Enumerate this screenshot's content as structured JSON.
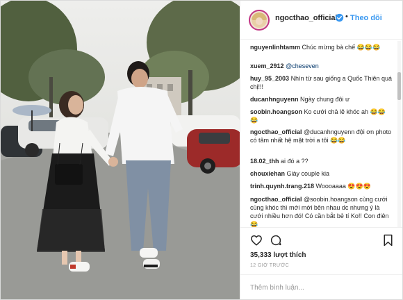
{
  "post": {
    "author": "ngocthao_official",
    "follow_label": "Theo dõi",
    "separator": "•",
    "verified": true,
    "likes": "35,333 lượt thích",
    "time_ago": "12 GIỜ TRƯỚC",
    "comment_placeholder": "Thêm bình luận..."
  },
  "comments": [
    {
      "user": "nguyenlinhtamm",
      "text": "Chúc mừng bà chế",
      "emoji": "😂😂😂",
      "mention": false
    },
    {
      "user": "xuem_2912",
      "text": "@cheseven",
      "emoji": "",
      "mention": true
    },
    {
      "user": "huy_95_2003",
      "text": "Nhìn từ sau giống a Quốc Thiên quá chị!!!",
      "emoji": "",
      "mention": false
    },
    {
      "user": "ducanhnguyenn",
      "text": "Ngày chung đôi ư",
      "emoji": "",
      "mention": false
    },
    {
      "user": "soobin.hoangson",
      "text": "Ko cưới chả lẽ khóc ah",
      "emoji": "😂😂😂",
      "mention": false
    },
    {
      "user": "ngocthao_official",
      "text": "@ducanhnguyenn đội ơn photo có tâm nhất hệ mặt trời a tôi",
      "emoji": "😂😂",
      "mention": false
    },
    {
      "user": "18.02_thh",
      "text": "ai đó a ??",
      "emoji": "",
      "mention": false
    },
    {
      "user": "chouxiehan",
      "text": "Giày couple kia",
      "emoji": "",
      "mention": false
    },
    {
      "user": "trinh.quynh.trang.218",
      "text": "Woooaaaa",
      "emoji": "😍😍😍",
      "mention": false
    },
    {
      "user": "ngocthao_official",
      "text": "@soobin.hoangson cùng cưới cùng khóc thì mới mới bên nhau dc nhưng ý là cưới nhiều hơn đó! Có cần bắt bẻ tí Ko!! Con điên",
      "emoji": "😂",
      "mention": false
    }
  ],
  "icons": {
    "like": "heart-icon",
    "comment": "comment-icon",
    "save": "bookmark-icon",
    "verified": "verified-badge-icon"
  },
  "colors": {
    "link": "#3897f0",
    "verified": "#3897f0",
    "text": "#262626",
    "muted": "#999999"
  }
}
